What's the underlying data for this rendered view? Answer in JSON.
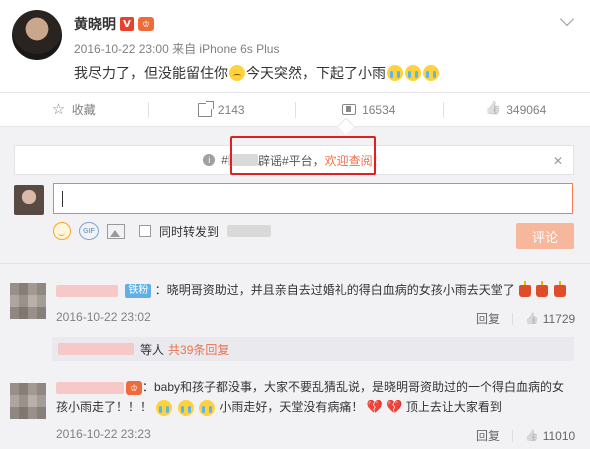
{
  "post": {
    "author": "黄晓明",
    "verified_mark": "V",
    "member_mark": "♔",
    "timestamp": "2016-10-22 23:00",
    "source": "来自 iPhone 6s Plus",
    "text_part1": "我尽力了，但没能留住你",
    "text_part2": "今天突然，下起了小雨"
  },
  "actions": {
    "favorite": "收藏",
    "repost_count": "2143",
    "comment_count": "16534",
    "like_count": "349064"
  },
  "notice": {
    "prefix": "#",
    "middle": "辟谣#平台，",
    "link": "欢迎查阅！",
    "close": "✕",
    "icon": "i"
  },
  "composer": {
    "gif_label": "GIF",
    "sync_label": "同时转发到",
    "submit_label": "评论"
  },
  "comments": [
    {
      "badge": "铁粉",
      "text": "：晓明哥资助过，并且亲自去过婚礼的得白血病的女孩小雨去天堂了",
      "timestamp": "2016-10-22 23:02",
      "reply": "回复",
      "likes": "11729",
      "replies_prefix": "等人",
      "replies_link": "共39条回复"
    },
    {
      "text_line1": "：baby和孩子都没事，大家不要乱猜乱说，是晓明哥资助过的一个得白血病的女",
      "text_line2a": "孩小雨走了！！！",
      "text_line2b": "小雨走好，天堂没有病痛！",
      "text_line2c": "顶上去让大家看到",
      "timestamp": "2016-10-22 23:23",
      "reply": "回复",
      "likes": "11010"
    }
  ],
  "colors": {
    "accent": "#eb7350",
    "highlight_frame": "#e02020",
    "verified": "#e8412c",
    "comment_bg": "#f2f2f5"
  }
}
